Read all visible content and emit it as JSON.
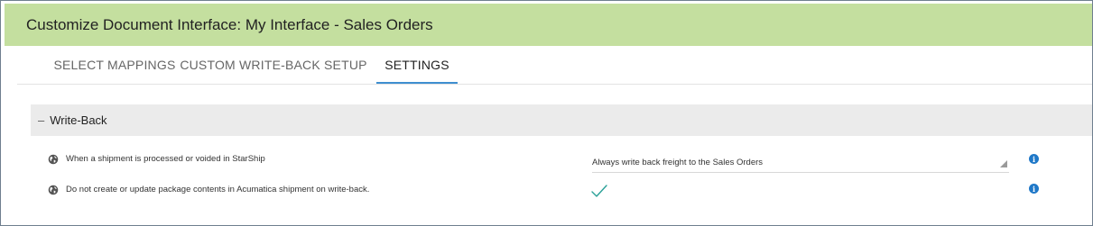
{
  "title": "Customize Document Interface:  My Interface - Sales Orders",
  "tabs": [
    {
      "label": "SELECT MAPPINGS"
    },
    {
      "label": "CUSTOM WRITE-BACK SETUP"
    },
    {
      "label": "SETTINGS",
      "active": true
    }
  ],
  "section": {
    "toggle": "–",
    "title": "Write-Back",
    "expanded": true
  },
  "settings": [
    {
      "label": "When a shipment is processed or voided in StarShip",
      "control": "select",
      "value": "Always write back freight to the Sales Orders",
      "icon": "globe-icon",
      "info_icon": "info-icon"
    },
    {
      "label": "Do not create or update package contents in Acumatica shipment on write-back.",
      "control": "checkbox",
      "checked": true,
      "icon": "globe-icon",
      "info_icon": "info-icon"
    }
  ],
  "colors": {
    "title_bar": "#c4df9f",
    "active_tab_underline": "#3f8fd0",
    "section_header": "#ebebeb",
    "checkmark": "#2aa198",
    "info_icon": "#1f78c8"
  }
}
